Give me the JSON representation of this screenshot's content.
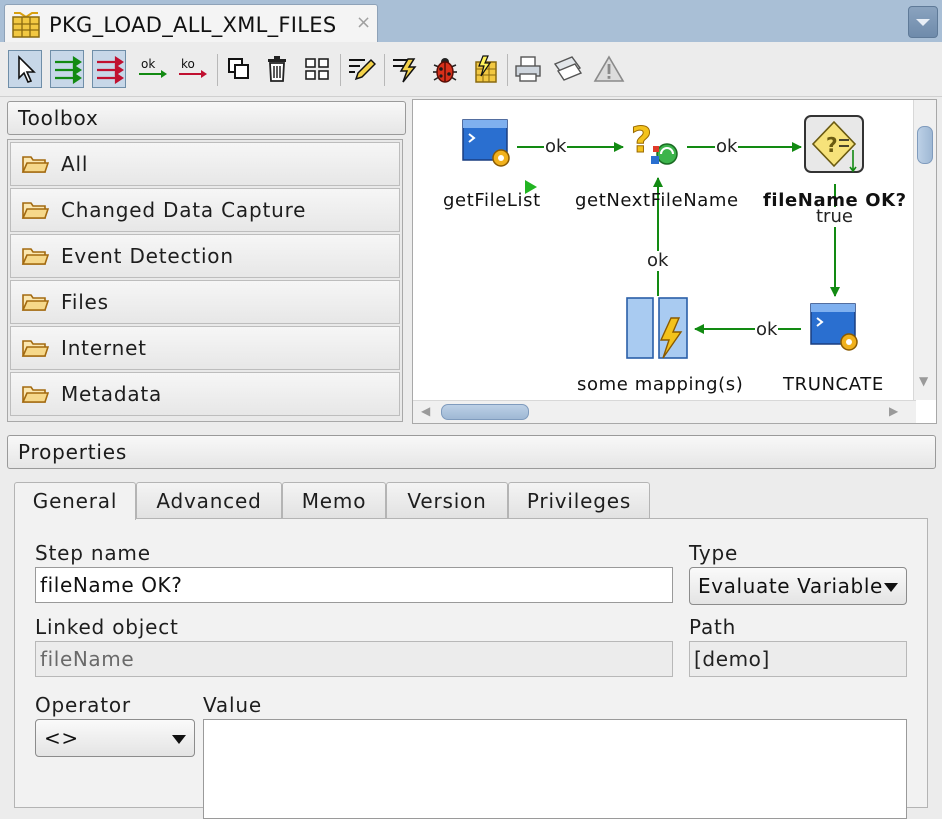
{
  "editor_tab": {
    "title": "PKG_LOAD_ALL_XML_FILES",
    "close": "×"
  },
  "toolbar": {
    "icons": [
      "select-pointer",
      "next-step-on-success",
      "next-step-on-failure",
      "ok-link",
      "ko-link",
      "duplicate-selection",
      "delete-selection",
      "arrange-steps",
      "edit-step",
      "execute-package",
      "debug-package",
      "execute-step",
      "print",
      "page-setup",
      "validate-warnings"
    ],
    "ok_label": "ok",
    "ko_label": "ko"
  },
  "toolbox": {
    "title": "Toolbox",
    "items": [
      {
        "label": "All"
      },
      {
        "label": "Changed Data Capture"
      },
      {
        "label": "Event Detection"
      },
      {
        "label": "Files"
      },
      {
        "label": "Internet"
      },
      {
        "label": "Metadata"
      }
    ]
  },
  "diagram": {
    "nodes": {
      "getFileList": "getFileList",
      "getNextFileName": "getNextFileName",
      "fileNameOK": "fileName OK?",
      "truncate": "TRUNCATE",
      "mapping": "some mapping(s)"
    },
    "edges": {
      "getFileList_to_getNext": "ok",
      "getNext_to_fileNameOK": "ok",
      "fileNameOK_to_truncate": "true",
      "truncate_to_mapping": "ok",
      "mapping_to_getNext": "ok"
    }
  },
  "properties": {
    "title": "Properties",
    "tabs": [
      {
        "label": "General",
        "active": true
      },
      {
        "label": "Advanced"
      },
      {
        "label": "Memo"
      },
      {
        "label": "Version"
      },
      {
        "label": "Privileges"
      }
    ],
    "general": {
      "step_name_label": "Step name",
      "step_name_value": "fileName OK?",
      "type_label": "Type",
      "type_value": "Evaluate Variable",
      "linked_object_label": "Linked object",
      "linked_object_value": "fileName",
      "path_label": "Path",
      "path_value": "[demo]",
      "operator_label": "Operator",
      "operator_value": "<>",
      "value_label": "Value",
      "value_value": ""
    }
  },
  "colors": {
    "success_link": "#128a12",
    "failure_link": "#c01030",
    "tab_strip": "#a9bfd6"
  }
}
